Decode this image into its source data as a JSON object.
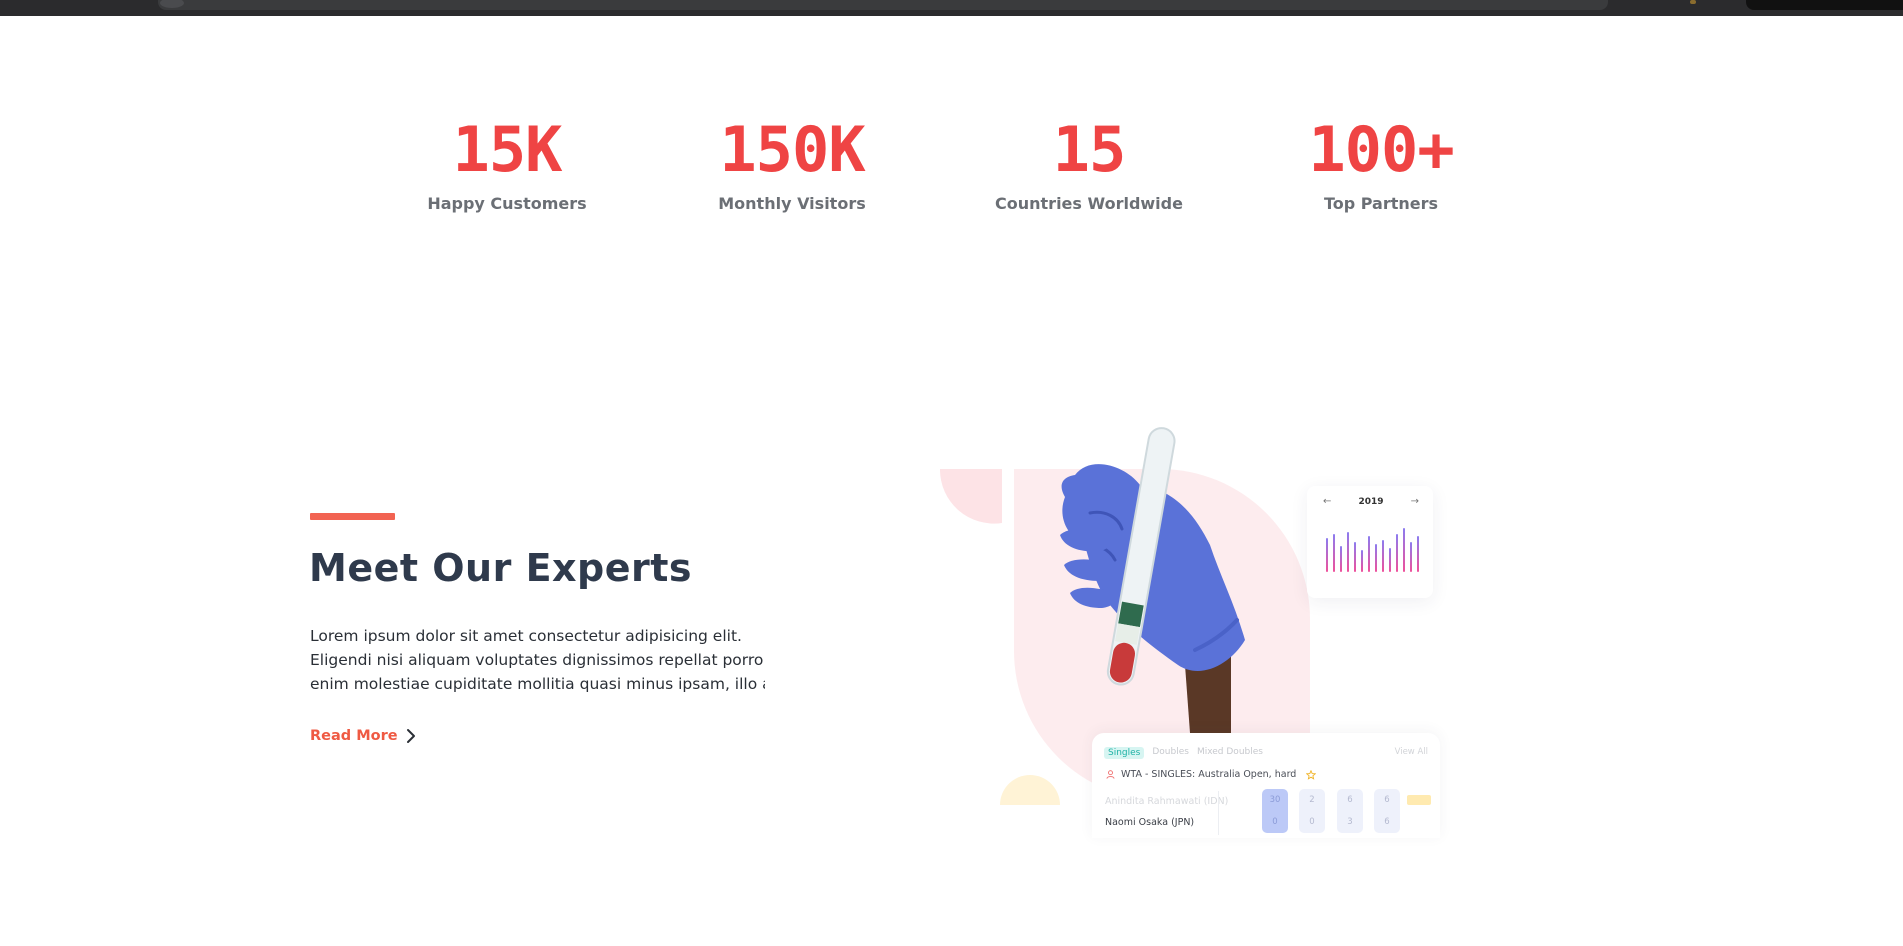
{
  "stats": [
    {
      "value": "15K",
      "label": "Happy Customers"
    },
    {
      "value": "150K",
      "label": "Monthly Visitors"
    },
    {
      "value": "15",
      "label": "Countries Worldwide"
    },
    {
      "value": "100+",
      "label": "Top Partners"
    }
  ],
  "experts": {
    "title": "Meet Our Experts",
    "description_lines": [
      "Lorem ipsum dolor sit amet consectetur adipisicing elit.",
      "Eligendi nisi aliquam voluptates dignissimos repellat porro",
      "enim molestiae cupiditate mollitia quasi minus ipsam, illo au..."
    ],
    "read_more": "Read More"
  },
  "year_card": {
    "year": "2019",
    "prev": "←",
    "next": "→"
  },
  "match_card": {
    "tabs": [
      "Singles",
      "Doubles",
      "Mixed Doubles"
    ],
    "view_all": "View All",
    "event": "WTA - SINGLES: Australia Open, hard",
    "players": [
      "Anindita Rahmawati (IDN)",
      "Naomi Osaka (JPN)"
    ],
    "scores": [
      {
        "top": "30",
        "bottom": "0"
      },
      {
        "top": "2",
        "bottom": "0"
      },
      {
        "top": "6",
        "bottom": "3"
      },
      {
        "top": "6",
        "bottom": "6"
      }
    ]
  },
  "colors": {
    "stat_red": "#ef4444",
    "accent": "#f26352",
    "title_navy": "#2f3a4c",
    "blob_pink": "#fdeaec",
    "glove_blue": "#5a72d8"
  },
  "icons": [
    "chevron-right-icon",
    "user-icon",
    "star-icon",
    "arrow-left-icon",
    "arrow-right-icon"
  ]
}
